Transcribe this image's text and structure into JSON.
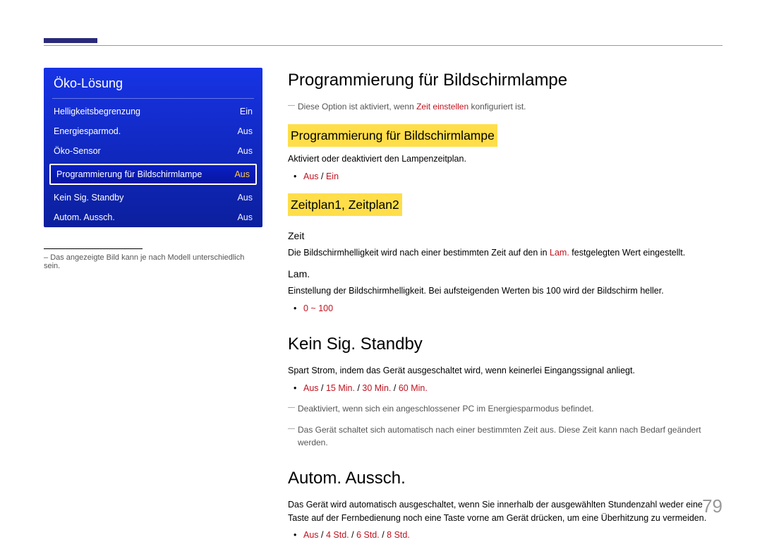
{
  "menu": {
    "title": "Öko-Lösung",
    "items": [
      {
        "label": "Helligkeitsbegrenzung",
        "value": "Ein",
        "selected": false
      },
      {
        "label": "Energiesparmod.",
        "value": "Aus",
        "selected": false
      },
      {
        "label": "Öko-Sensor",
        "value": "Aus",
        "selected": false
      },
      {
        "label": "Programmierung für Bildschirmlampe",
        "value": "Aus",
        "selected": true
      },
      {
        "label": "Kein Sig. Standby",
        "value": "Aus",
        "selected": false
      },
      {
        "label": "Autom. Aussch.",
        "value": "Aus",
        "selected": false
      }
    ],
    "footnote": "Das angezeigte Bild kann je nach Modell unterschiedlich sein."
  },
  "s1": {
    "h1": "Programmierung für Bildschirmlampe",
    "note_pre": "Diese Option ist aktiviert, wenn ",
    "note_em": "Zeit einstellen",
    "note_post": " konfiguriert ist.",
    "h2a": "Programmierung für Bildschirmlampe",
    "h2a_desc": "Aktiviert oder deaktiviert den Lampenzeitplan.",
    "h2a_opts": [
      "Aus",
      "Ein"
    ],
    "h2b": "Zeitplan1, Zeitplan2",
    "h3_zeit": "Zeit",
    "zeit_desc_pre": "Die Bildschirmhelligkeit wird nach einer bestimmten Zeit auf den in ",
    "zeit_desc_em": "Lam.",
    "zeit_desc_post": " festgelegten Wert eingestellt.",
    "h3_lam": "Lam.",
    "lam_desc": "Einstellung der Bildschirmhelligkeit. Bei aufsteigenden Werten bis 100 wird der Bildschirm heller.",
    "lam_range": "0 ~ 100"
  },
  "s2": {
    "h1": "Kein Sig. Standby",
    "desc": "Spart Strom, indem das Gerät ausgeschaltet wird, wenn keinerlei Eingangssignal anliegt.",
    "opts": [
      "Aus",
      "15 Min.",
      "30 Min.",
      "60 Min."
    ],
    "note1": "Deaktiviert, wenn sich ein angeschlossener PC im Energiesparmodus befindet.",
    "note2": "Das Gerät schaltet sich automatisch nach einer bestimmten Zeit aus. Diese Zeit kann nach Bedarf geändert werden."
  },
  "s3": {
    "h1": "Autom. Aussch.",
    "desc": "Das Gerät wird automatisch ausgeschaltet, wenn Sie innerhalb der ausgewählten Stundenzahl weder eine Taste auf der Fernbedienung noch eine Taste vorne am Gerät drücken, um eine Überhitzung zu vermeiden.",
    "opts": [
      "Aus",
      "4 Std.",
      "6 Std.",
      "8 Std."
    ]
  },
  "page_number": "79"
}
